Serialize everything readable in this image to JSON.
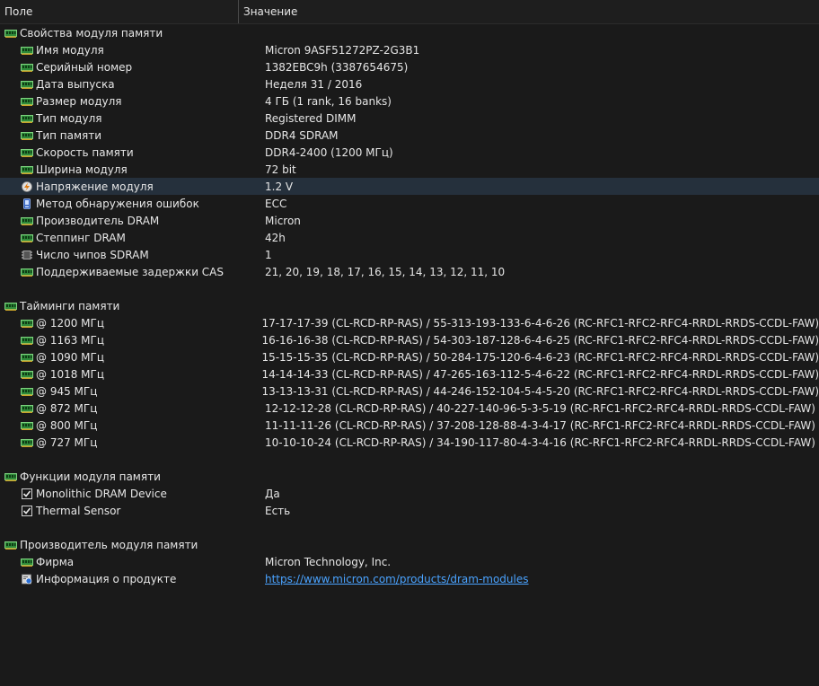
{
  "header": {
    "field": "Поле",
    "value": "Значение"
  },
  "sections": [
    {
      "title": "Свойства модуля памяти",
      "icon": "memory-module-icon",
      "items": [
        {
          "field": "Имя модуля",
          "value": "Micron 9ASF51272PZ-2G3B1",
          "icon": "memory-module-icon"
        },
        {
          "field": "Серийный номер",
          "value": "1382EBC9h (3387654675)",
          "icon": "memory-module-icon"
        },
        {
          "field": "Дата выпуска",
          "value": "Неделя 31 / 2016",
          "icon": "memory-module-icon"
        },
        {
          "field": "Размер модуля",
          "value": "4 ГБ (1 rank, 16 banks)",
          "icon": "memory-module-icon"
        },
        {
          "field": "Тип модуля",
          "value": "Registered DIMM",
          "icon": "memory-module-icon"
        },
        {
          "field": "Тип памяти",
          "value": "DDR4 SDRAM",
          "icon": "memory-module-icon"
        },
        {
          "field": "Скорость памяти",
          "value": "DDR4-2400 (1200 МГц)",
          "icon": "memory-module-icon"
        },
        {
          "field": "Ширина модуля",
          "value": "72 bit",
          "icon": "memory-module-icon"
        },
        {
          "field": "Напряжение модуля",
          "value": "1.2 V",
          "icon": "voltage-icon",
          "selected": true
        },
        {
          "field": "Метод обнаружения ошибок",
          "value": "ECC",
          "icon": "error-detection-icon"
        },
        {
          "field": "Производитель DRAM",
          "value": "Micron",
          "icon": "memory-module-icon"
        },
        {
          "field": "Степпинг DRAM",
          "value": "42h",
          "icon": "memory-module-icon"
        },
        {
          "field": "Число чипов SDRAM",
          "value": "1",
          "icon": "chip-icon"
        },
        {
          "field": "Поддерживаемые задержки CAS",
          "value": "21, 20, 19, 18, 17, 16, 15, 14, 13, 12, 11, 10",
          "icon": "memory-module-icon"
        }
      ]
    },
    {
      "title": "Тайминги памяти",
      "icon": "memory-module-icon",
      "items": [
        {
          "field": "@ 1200 МГц",
          "value": "17-17-17-39  (CL-RCD-RP-RAS) / 55-313-193-133-6-4-6-26  (RC-RFC1-RFC2-RFC4-RRDL-RRDS-CCDL-FAW)",
          "icon": "memory-module-icon"
        },
        {
          "field": "@ 1163 МГц",
          "value": "16-16-16-38  (CL-RCD-RP-RAS) / 54-303-187-128-6-4-6-25  (RC-RFC1-RFC2-RFC4-RRDL-RRDS-CCDL-FAW)",
          "icon": "memory-module-icon"
        },
        {
          "field": "@ 1090 МГц",
          "value": "15-15-15-35  (CL-RCD-RP-RAS) / 50-284-175-120-6-4-6-23  (RC-RFC1-RFC2-RFC4-RRDL-RRDS-CCDL-FAW)",
          "icon": "memory-module-icon"
        },
        {
          "field": "@ 1018 МГц",
          "value": "14-14-14-33  (CL-RCD-RP-RAS) / 47-265-163-112-5-4-6-22  (RC-RFC1-RFC2-RFC4-RRDL-RRDS-CCDL-FAW)",
          "icon": "memory-module-icon"
        },
        {
          "field": "@ 945 МГц",
          "value": "13-13-13-31  (CL-RCD-RP-RAS) / 44-246-152-104-5-4-5-20  (RC-RFC1-RFC2-RFC4-RRDL-RRDS-CCDL-FAW)",
          "icon": "memory-module-icon"
        },
        {
          "field": "@ 872 МГц",
          "value": "12-12-12-28  (CL-RCD-RP-RAS) / 40-227-140-96-5-3-5-19  (RC-RFC1-RFC2-RFC4-RRDL-RRDS-CCDL-FAW)",
          "icon": "memory-module-icon"
        },
        {
          "field": "@ 800 МГц",
          "value": "11-11-11-26  (CL-RCD-RP-RAS) / 37-208-128-88-4-3-4-17  (RC-RFC1-RFC2-RFC4-RRDL-RRDS-CCDL-FAW)",
          "icon": "memory-module-icon"
        },
        {
          "field": "@ 727 МГц",
          "value": "10-10-10-24  (CL-RCD-RP-RAS) / 34-190-117-80-4-3-4-16  (RC-RFC1-RFC2-RFC4-RRDL-RRDS-CCDL-FAW)",
          "icon": "memory-module-icon"
        }
      ]
    },
    {
      "title": "Функции модуля памяти",
      "icon": "memory-module-icon",
      "items": [
        {
          "field": "Monolithic DRAM Device",
          "value": "Да",
          "icon": "checkbox-checked-icon"
        },
        {
          "field": "Thermal Sensor",
          "value": "Есть",
          "icon": "checkbox-checked-icon"
        }
      ]
    },
    {
      "title": "Производитель модуля памяти",
      "icon": "memory-module-icon",
      "items": [
        {
          "field": "Фирма",
          "value": "Micron Technology, Inc.",
          "icon": "memory-module-icon"
        },
        {
          "field": "Информация о продукте",
          "value": "https://www.micron.com/products/dram-modules",
          "icon": "web-link-icon",
          "link": true
        }
      ]
    }
  ],
  "colors": {
    "background": "#1a1a1a",
    "text": "#e6e6e6",
    "selected_row": "#25303c",
    "link": "#4aa3ff",
    "module_icon": "#2e8b3a"
  }
}
